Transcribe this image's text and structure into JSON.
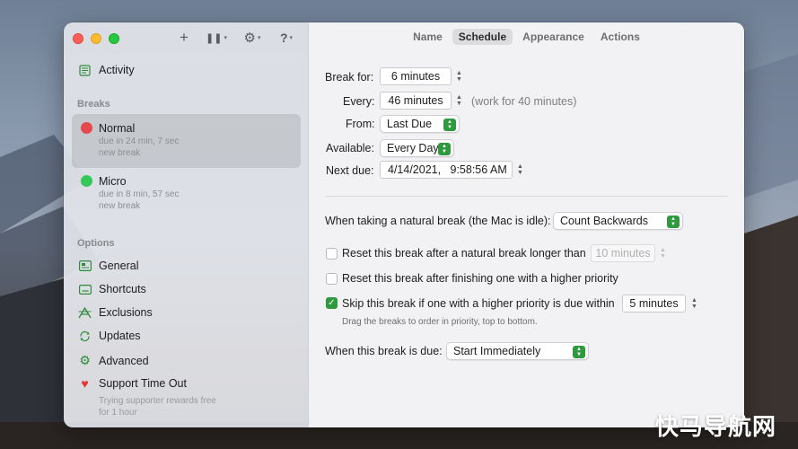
{
  "toolbar": {
    "add_symbol": "+",
    "pause_symbol": "❚❚",
    "settings_symbol": "⚙",
    "help_symbol": "?",
    "chevron": "▾"
  },
  "sidebar": {
    "activity_label": "Activity",
    "breaks_heading": "Breaks",
    "breaks": [
      {
        "name": "Normal",
        "due": "due in 24 min, 7 sec",
        "kind": "new break",
        "color": "#e5484d"
      },
      {
        "name": "Micro",
        "due": "due in 8 min, 57 sec",
        "kind": "new break",
        "color": "#34c759"
      }
    ],
    "options_heading": "Options",
    "options": [
      {
        "label": "General",
        "icon": "general-icon"
      },
      {
        "label": "Shortcuts",
        "icon": "keyboard-icon"
      },
      {
        "label": "Exclusions",
        "icon": "exclusions-icon"
      },
      {
        "label": "Updates",
        "icon": "updates-icon"
      },
      {
        "label": "Advanced",
        "icon": "gear-icon"
      },
      {
        "label": "Support Time Out",
        "icon": "heart-icon"
      }
    ],
    "support_note_line1": "Trying supporter rewards free",
    "support_note_line2": "for 1 hour"
  },
  "tabs": [
    {
      "label": "Name"
    },
    {
      "label": "Schedule"
    },
    {
      "label": "Appearance"
    },
    {
      "label": "Actions"
    }
  ],
  "schedule": {
    "break_for_label": "Break for:",
    "break_for_value": "6 minutes",
    "every_label": "Every:",
    "every_value": "46 minutes",
    "every_note": "(work for 40 minutes)",
    "from_label": "From:",
    "from_value": "Last Due",
    "available_label": "Available:",
    "available_value": "Every Day",
    "next_due_label": "Next due:",
    "next_due_value": "4/14/2021,   9:58:56 AM",
    "natural_break_label": "When taking a natural break (the Mac is idle):",
    "natural_break_value": "Count Backwards",
    "reset_natural_label": "Reset this break after a natural break longer than",
    "reset_natural_value": "10 minutes",
    "reset_natural_checked": false,
    "reset_higher_label": "Reset this break after finishing one with a higher priority",
    "reset_higher_checked": false,
    "skip_label": "Skip this break if one with a higher priority is due within",
    "skip_value": "5 minutes",
    "skip_checked": true,
    "skip_hint": "Drag the breaks to order in priority, top to bottom.",
    "when_due_label": "When this break is due:",
    "when_due_value": "Start Immediately"
  },
  "colors": {
    "accent": "#2e9a3d"
  },
  "watermark": "快马导航网"
}
